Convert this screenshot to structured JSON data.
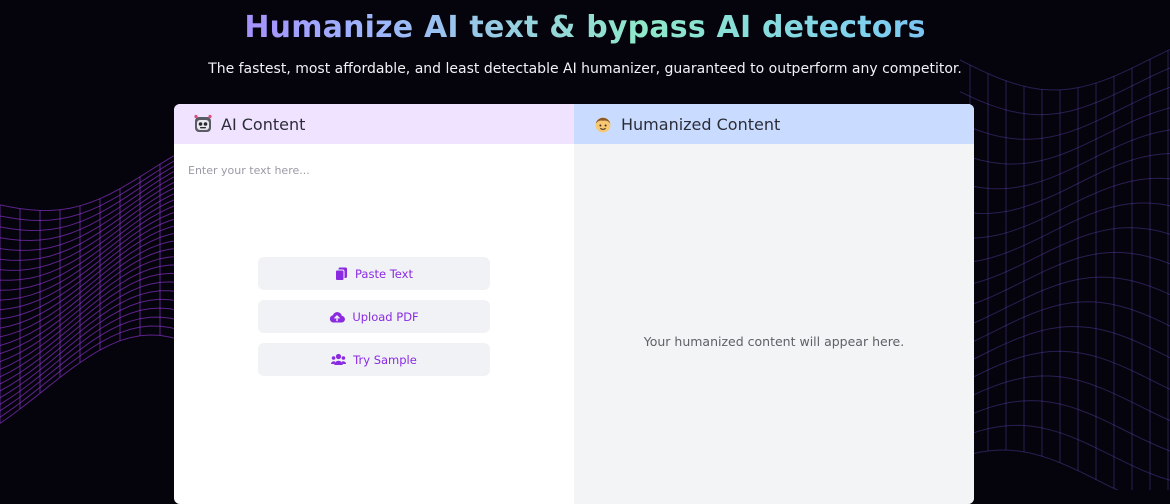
{
  "hero": {
    "title": "Humanize AI text & bypass AI detectors",
    "subtitle": "The fastest, most affordable, and least detectable AI humanizer, guaranteed to outperform any competitor."
  },
  "ai_panel": {
    "header_icon": "robot-face-icon",
    "header_label": "AI Content",
    "input_placeholder": "Enter your text here...",
    "input_value": "",
    "buttons": [
      {
        "label": "Paste Text",
        "icon": "clipboard-icon"
      },
      {
        "label": "Upload PDF",
        "icon": "cloud-upload-icon"
      },
      {
        "label": "Try Sample",
        "icon": "users-icon"
      }
    ]
  },
  "humanized_panel": {
    "header_icon": "person-face-icon",
    "header_label": "Humanized Content",
    "placeholder_text": "Your humanized content will appear here."
  },
  "colors": {
    "background": "#05040c",
    "accent_purple": "#8a2be2",
    "ai_header_bg": "#efe3ff",
    "humanized_header_bg": "#c9dcff",
    "wave_lines": "#a43cf0"
  }
}
